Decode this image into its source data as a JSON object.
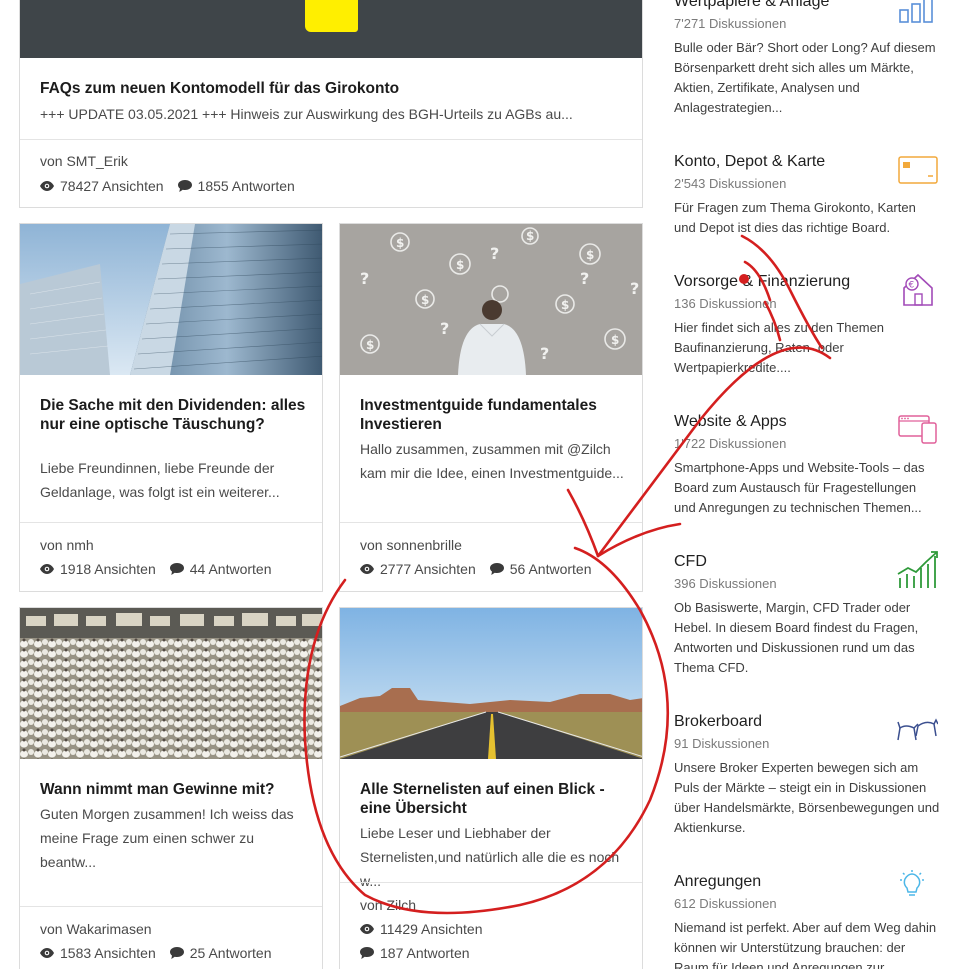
{
  "cards": [
    {
      "title": "FAQs zum neuen Kontomodell für das Girokonto",
      "excerpt": "+++ UPDATE 03.05.2021 +++ Hinweis zur Auswirkung des BGH-Urteils zu AGBs au...",
      "author": "von SMT_Erik",
      "views": "78427 Ansichten",
      "answers": "1855 Antworten"
    },
    {
      "title": "Die Sache mit den Dividenden: alles nur eine optische Täuschung?",
      "excerpt": "Liebe Freundinnen, liebe Freunde der Geldanlage, was folgt ist ein weiterer...",
      "author": "von nmh",
      "views": "1918 Ansichten",
      "answers": "44 Antworten"
    },
    {
      "title": "Investmentguide fundamentales Investieren",
      "excerpt": "Hallo zusammen, zusammen mit @Zilch kam mir die Idee, einen Investmentguide...",
      "author": "von sonnenbrille",
      "views": "2777 Ansichten",
      "answers": "56 Antworten"
    },
    {
      "title": "Wann nimmt man Gewinne mit?",
      "excerpt": "Guten Morgen zusammen! Ich weiss das meine Frage zum einen schwer zu beantw...",
      "author": "von Wakarimasen",
      "views": "1583 Ansichten",
      "answers": "25 Antworten"
    },
    {
      "title": "Alle Sternelisten auf einen Blick - eine Übersicht",
      "excerpt": "Liebe Leser und Liebhaber der Sternelisten,und natürlich alle die es noch w...",
      "author": "von Zilch",
      "views": "11429 Ansichten",
      "answers": "187 Antworten"
    }
  ],
  "boards": [
    {
      "title": "Wertpapiere & Anlage",
      "count": "7'271 Diskussionen",
      "description": "Bulle oder Bär? Short oder Long? Auf diesem Börsenparkett dreht sich alles um Märkte, Aktien, Zertifikate, Analysen und Anlagestrategien...",
      "icon": "bar-chart-icon"
    },
    {
      "title": "Konto, Depot & Karte",
      "count": "2'543 Diskussionen",
      "description": "Für Fragen zum Thema Girokonto, Karten und Depot ist dies das richtige Board.",
      "icon": "credit-card-icon"
    },
    {
      "title": "Vorsorge & Finanzierung",
      "count": "136 Diskussionen",
      "description": "Hier findet sich alles zu den Themen Baufinanzierung, Raten- oder Wertpapierkredite....",
      "icon": "house-euro-icon"
    },
    {
      "title": "Website & Apps",
      "count": "1'722 Diskussionen",
      "description": "Smartphone-Apps und Website-Tools – das Board zum Austausch für Fragestellungen und Anregungen zu technischen Themen...",
      "icon": "devices-icon"
    },
    {
      "title": "CFD",
      "count": "396 Diskussionen",
      "description": "Ob Basiswerte, Margin, CFD Trader oder Hebel. In diesem Board findest du Fragen, Antworten und Diskussionen rund um das Thema CFD.",
      "icon": "growth-chart-icon"
    },
    {
      "title": "Brokerboard",
      "count": "91 Diskussionen",
      "description": "Unsere Broker Experten bewegen sich am Puls der Märkte – steigt ein in Diskussionen über Handelsmärkte, Börsenbewegungen und Aktienkurse.",
      "icon": "bull-bear-icon"
    },
    {
      "title": "Anregungen",
      "count": "612 Diskussionen",
      "description": "Niemand ist perfekt. Aber auf dem Weg dahin können wir Unterstützung brauchen: der Raum für Ideen und Anregungen zur...",
      "icon": "lightbulb-icon"
    }
  ],
  "colors": {
    "accent_yellow": "#ffef00",
    "annotation_red": "#d41f1f",
    "icon_blue": "#5a8fd8",
    "icon_orange": "#f2a93b",
    "icon_purple": "#a24bb8",
    "icon_pink": "#e0609a",
    "icon_green": "#2f9a3a",
    "icon_navy": "#3b4f8f",
    "icon_lightblue": "#4cb7e8"
  }
}
